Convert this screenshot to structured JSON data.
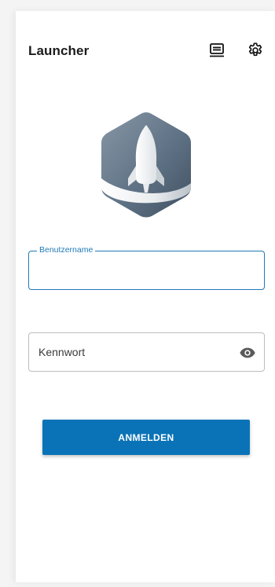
{
  "app": {
    "title": "Launcher"
  },
  "header": {
    "kiosk_icon": "display-screen-icon",
    "settings_icon": "gear-icon"
  },
  "form": {
    "username": {
      "label": "Benutzername",
      "value": ""
    },
    "password": {
      "placeholder": "Kennwort",
      "value": "",
      "toggle_icon": "eye-icon"
    },
    "submit_label": "ANMELDEN"
  },
  "colors": {
    "accent": "#0a73b7",
    "focus_border": "#1f7ab8",
    "logo_hexagon": "#5f7285",
    "logo_swoosh": "#c8cdd2"
  }
}
